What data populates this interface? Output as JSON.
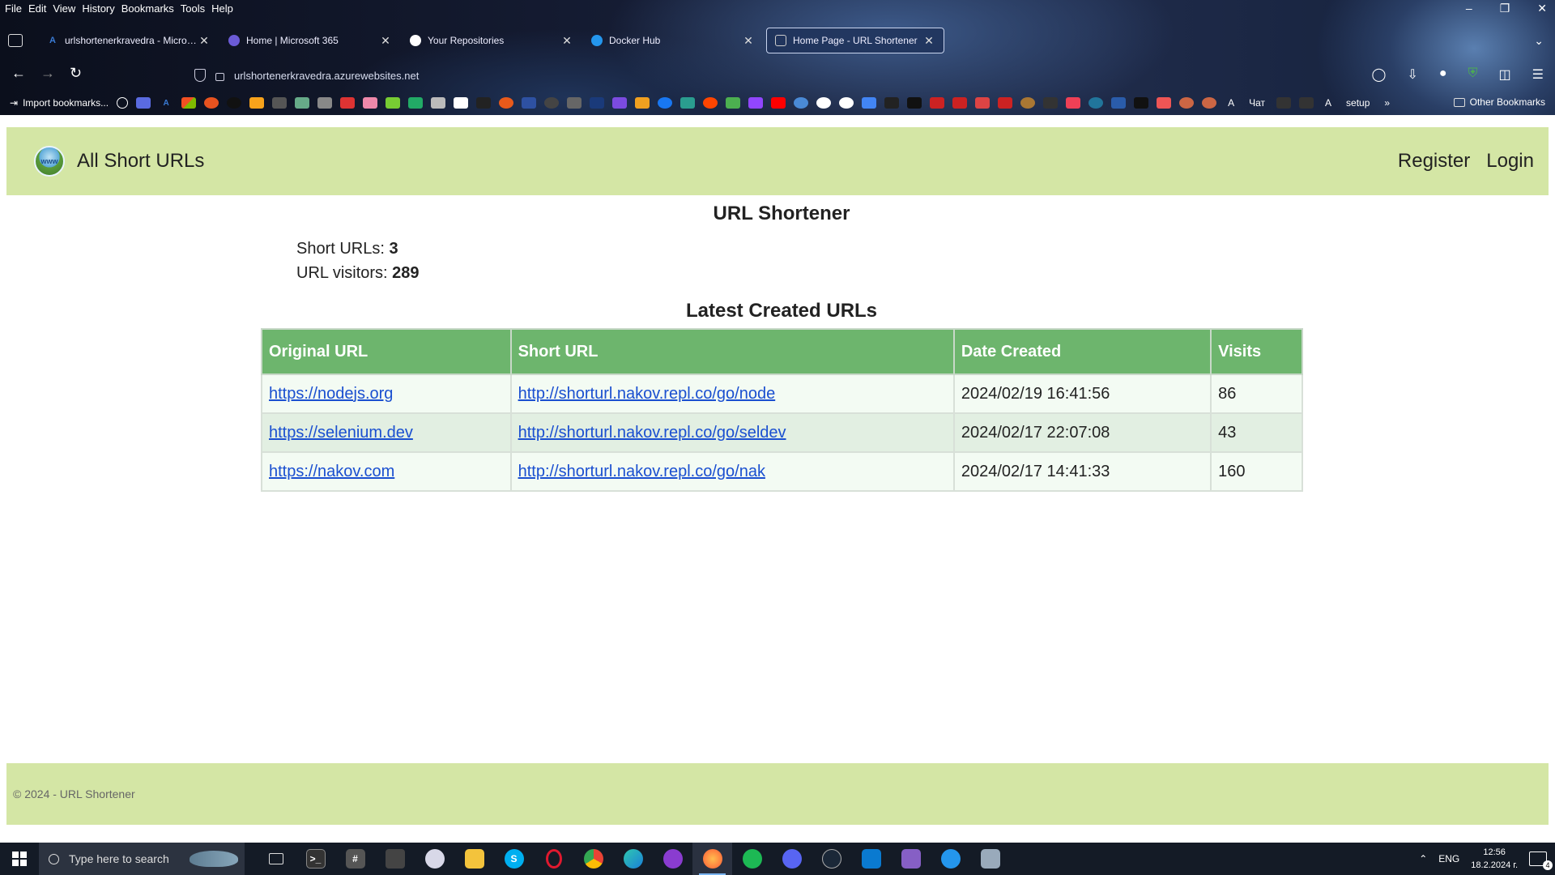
{
  "browser": {
    "menu": [
      "File",
      "Edit",
      "View",
      "History",
      "Bookmarks",
      "Tools",
      "Help"
    ],
    "tabs": [
      {
        "title": "urlshortenerkravedra - Microsoft",
        "icon": "azure-icon",
        "color": "#3a7bd5"
      },
      {
        "title": "Home | Microsoft 365",
        "icon": "m365-icon",
        "color": "#6b5bd6"
      },
      {
        "title": "Your Repositories",
        "icon": "github-icon",
        "color": "#ffffff"
      },
      {
        "title": "Docker Hub",
        "icon": "docker-icon",
        "color": "#2496ed"
      },
      {
        "title": "Home Page - URL Shortener",
        "icon": "page-icon",
        "color": "#cccccc"
      }
    ],
    "url": "urlshortenerkravedra.azurewebsites.net",
    "bookmarks": {
      "import_label": "Import bookmarks...",
      "chat_label": "Чат",
      "a_label": "A",
      "setup_label": "setup",
      "other_label": "Other Bookmarks"
    }
  },
  "page": {
    "brand": "All Short URLs",
    "nav": {
      "register": "Register",
      "login": "Login"
    },
    "title": "URL Shortener",
    "stats": {
      "short_urls_label": "Short URLs: ",
      "short_urls_value": "3",
      "visitors_label": "URL visitors: ",
      "visitors_value": "289"
    },
    "table_title": "Latest Created URLs",
    "table": {
      "headers": [
        "Original URL",
        "Short URL",
        "Date Created",
        "Visits"
      ],
      "rows": [
        {
          "original": "https://nodejs.org",
          "short": "http://shorturl.nakov.repl.co/go/node",
          "date": "2024/02/19 16:41:56",
          "visits": "86"
        },
        {
          "original": "https://selenium.dev",
          "short": "http://shorturl.nakov.repl.co/go/seldev",
          "date": "2024/02/17 22:07:08",
          "visits": "43"
        },
        {
          "original": "https://nakov.com",
          "short": "http://shorturl.nakov.repl.co/go/nak",
          "date": "2024/02/17 14:41:33",
          "visits": "160"
        }
      ]
    },
    "footer": "© 2024 - URL Shortener"
  },
  "taskbar": {
    "search_placeholder": "Type here to search",
    "lang": "ENG",
    "time": "12:56",
    "date": "18.2.2024 г.",
    "notifications": "4"
  }
}
